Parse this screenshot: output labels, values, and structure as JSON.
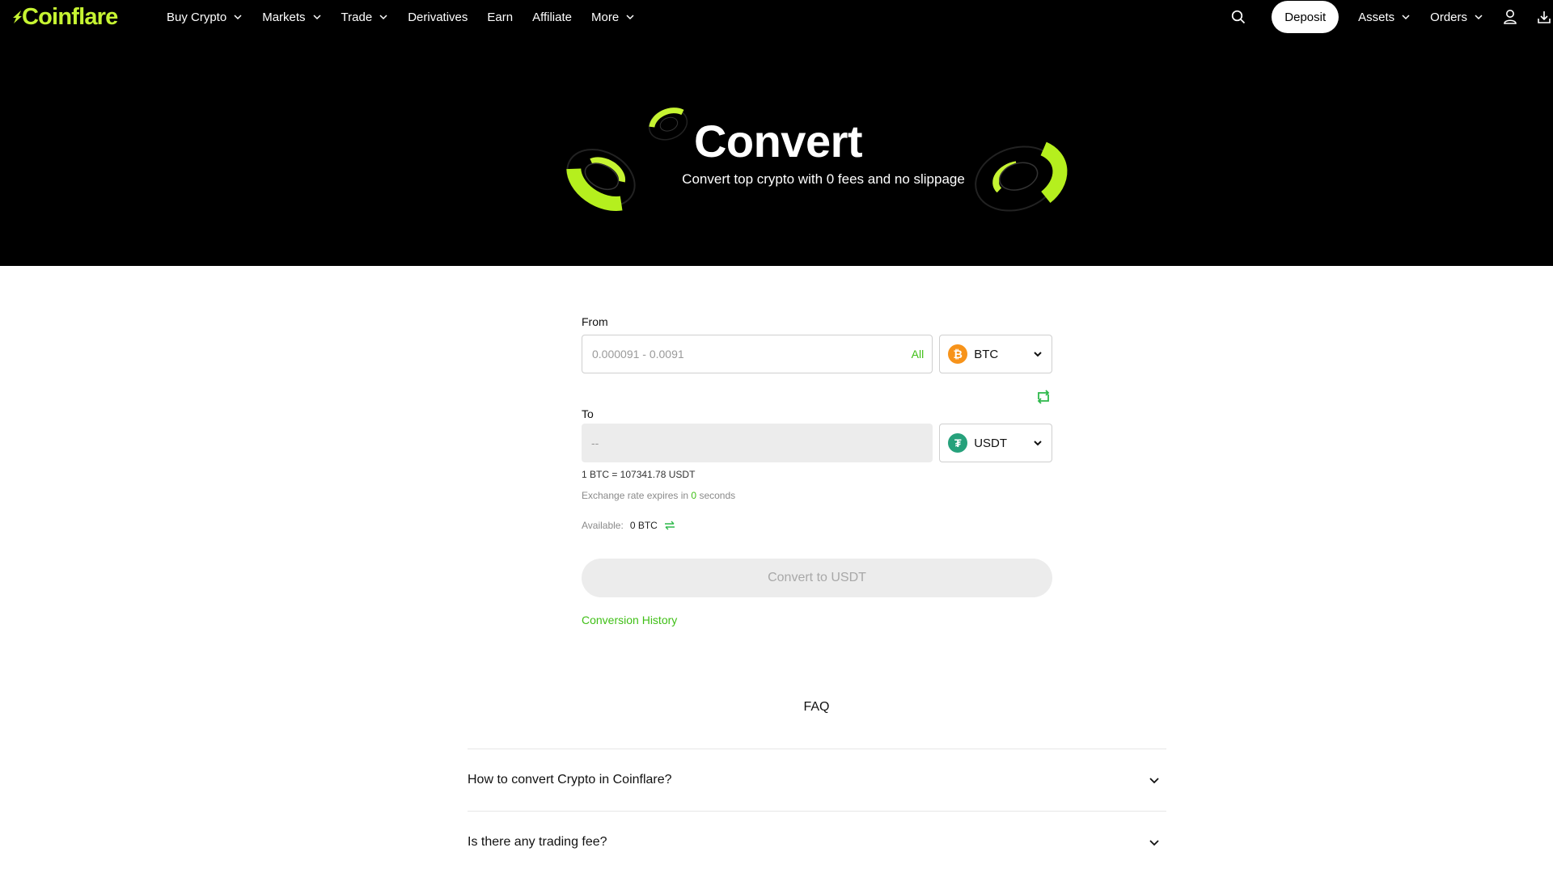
{
  "brand": {
    "name": "Coinflare",
    "accent": "#c6f432",
    "green": "#3fbf16"
  },
  "nav": {
    "items": [
      {
        "label": "Buy Crypto",
        "has_dropdown": true
      },
      {
        "label": "Markets",
        "has_dropdown": true
      },
      {
        "label": "Trade",
        "has_dropdown": true
      },
      {
        "label": "Derivatives",
        "has_dropdown": false
      },
      {
        "label": "Earn",
        "has_dropdown": false
      },
      {
        "label": "Affiliate",
        "has_dropdown": false
      },
      {
        "label": "More",
        "has_dropdown": true
      }
    ],
    "deposit_label": "Deposit",
    "assets_label": "Assets",
    "orders_label": "Orders",
    "icons": [
      "search-icon",
      "user-icon",
      "download-icon"
    ]
  },
  "hero": {
    "title": "Convert",
    "subtitle": "Convert top crypto with 0 fees and no slippage"
  },
  "convert": {
    "from_label": "From",
    "from_placeholder": "0.000091 - 0.0091",
    "all_label": "All",
    "from_coin": "BTC",
    "to_label": "To",
    "to_placeholder": "--",
    "to_coin": "USDT",
    "rate_text": "1 BTC = 107341.78 USDT",
    "expires_prefix": "Exchange rate expires in",
    "expires_seconds": "0",
    "expires_suffix": "seconds",
    "available_label": "Available:",
    "available_value": "0 BTC",
    "convert_button": "Convert to USDT",
    "history_link": "Conversion History"
  },
  "faq": {
    "title": "FAQ",
    "items": [
      {
        "question": "How to convert Crypto in Coinflare?"
      },
      {
        "question": "Is there any trading fee?"
      }
    ]
  }
}
